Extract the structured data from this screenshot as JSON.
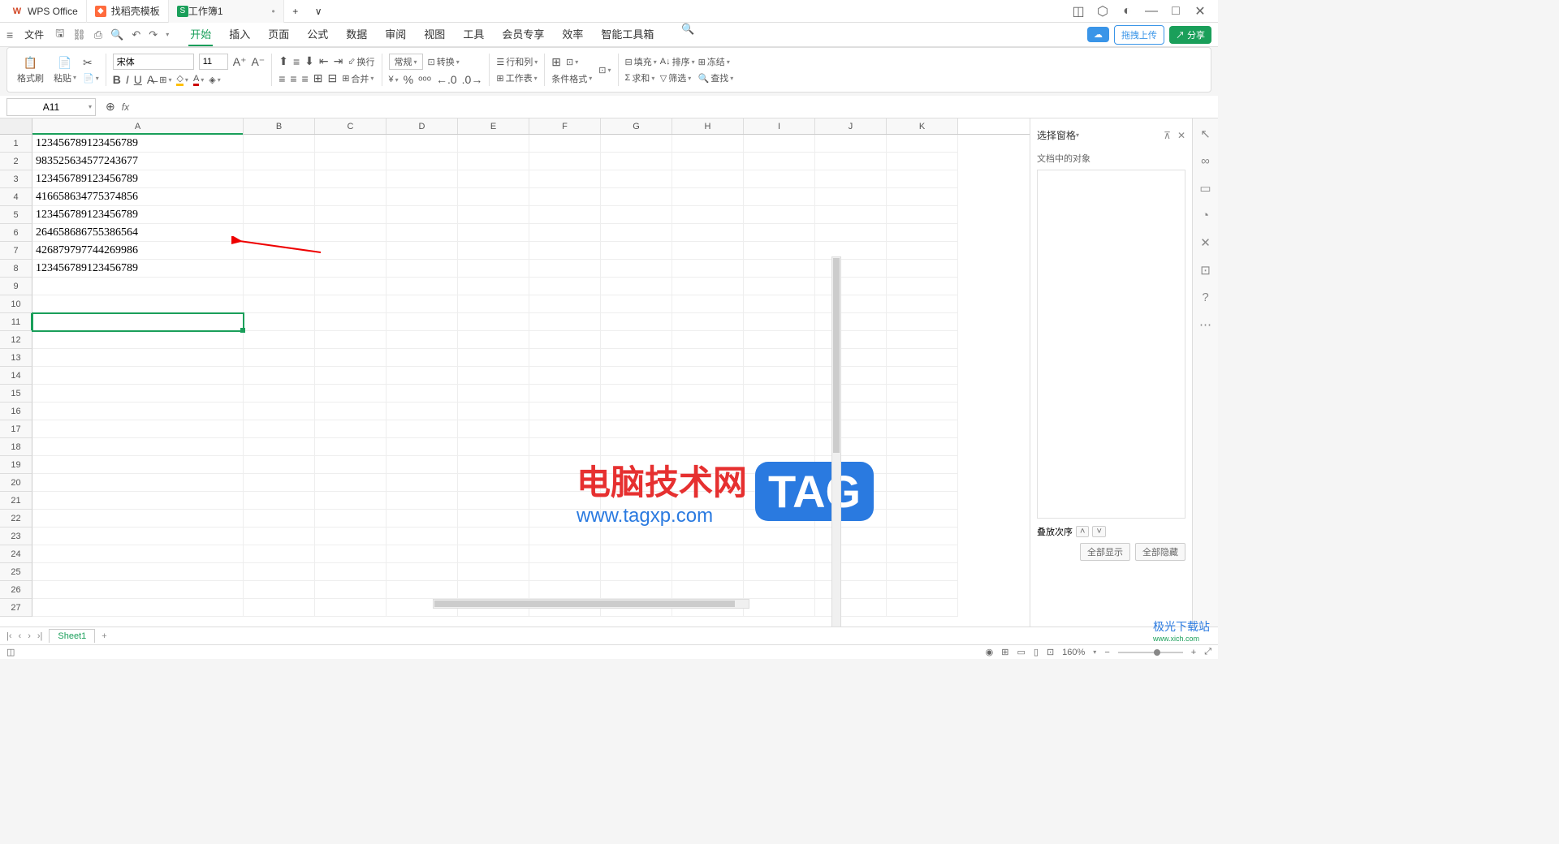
{
  "titlebar": {
    "tabs": [
      {
        "icon": "W",
        "label": "WPS Office"
      },
      {
        "icon": "◆",
        "label": "找稻壳模板"
      },
      {
        "icon": "S",
        "label": "工作簿1",
        "modified": "•"
      }
    ]
  },
  "menubar": {
    "file": "文件",
    "tabs": [
      "开始",
      "插入",
      "页面",
      "公式",
      "数据",
      "审阅",
      "视图",
      "工具",
      "会员专享",
      "效率",
      "智能工具箱"
    ],
    "active": 0,
    "cloud": "",
    "upload": "拖拽上传",
    "share": "分享"
  },
  "ribbon": {
    "format_painter": "格式刷",
    "paste": "粘贴",
    "font": "宋体",
    "size": "11",
    "wrap": "换行",
    "merge": "合并",
    "general": "常规",
    "convert": "转换",
    "rowcol": "行和列",
    "worksheet": "工作表",
    "cond_format": "条件格式",
    "fill": "填充",
    "sort": "排序",
    "freeze": "冻结",
    "sum": "求和",
    "filter": "筛选",
    "find": "查找"
  },
  "formula_bar": {
    "name_box": "A11"
  },
  "columns": [
    "A",
    "B",
    "C",
    "D",
    "E",
    "F",
    "G",
    "H",
    "I",
    "J",
    "K"
  ],
  "rows": [
    "1",
    "2",
    "3",
    "4",
    "5",
    "6",
    "7",
    "8",
    "9",
    "10",
    "11",
    "12",
    "13",
    "14",
    "15",
    "16",
    "17",
    "18",
    "19",
    "20",
    "21",
    "22",
    "23",
    "24",
    "25",
    "26",
    "27"
  ],
  "data": {
    "A": [
      "123456789123456789",
      "983525634577243677",
      "123456789123456789",
      "416658634775374856",
      "123456789123456789",
      "264658686755386564",
      "426879797744269986",
      "123456789123456789"
    ]
  },
  "right_panel": {
    "title": "选择窗格",
    "subtitle": "文档中的对象",
    "stack_order": "叠放次序",
    "show_all": "全部显示",
    "hide_all": "全部隐藏"
  },
  "sheet_tabs": {
    "name": "Sheet1"
  },
  "statusbar": {
    "zoom": "160%"
  },
  "watermark": {
    "cn": "电脑技术网",
    "url": "www.tagxp.com",
    "tag": "TAG",
    "corner": "极光下载站",
    "corner_url": "www.xich.com"
  }
}
